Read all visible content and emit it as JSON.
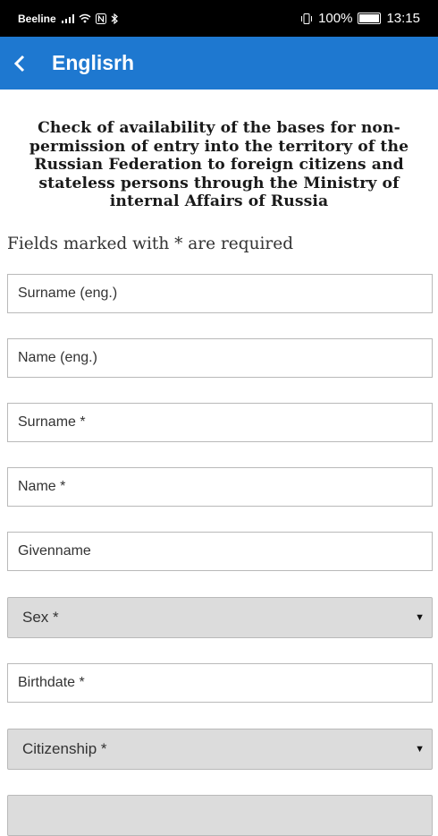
{
  "status_bar": {
    "carrier": "Beeline",
    "battery_percent": "100%",
    "time": "13:15"
  },
  "app_bar": {
    "title": "Englisrh"
  },
  "heading": "Check of availability of the bases for non-permission of entry into the territory of the Russian Federation to foreign citizens and stateless persons through the Ministry of internal Affairs of Russia",
  "required_note": "Fields marked with * are required",
  "fields": {
    "surname_eng": "Surname (eng.)",
    "name_eng": "Name (eng.)",
    "surname": "Surname *",
    "name": "Name *",
    "givenname": "Givenname",
    "sex": "Sex *",
    "birthdate": "Birthdate *",
    "citizenship": "Citizenship *"
  },
  "colors": {
    "app_bar": "#1e78d0",
    "select_bg": "#dcdcdc"
  }
}
